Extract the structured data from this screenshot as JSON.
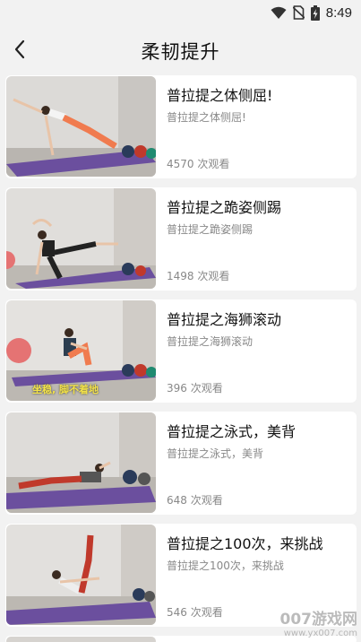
{
  "status_bar": {
    "time": "8:49",
    "icons": [
      "wifi-icon",
      "no-sim-icon",
      "battery-charging-icon"
    ]
  },
  "header": {
    "back_icon": "back-arrow-icon",
    "title": "柔韧提升"
  },
  "videos": [
    {
      "title": "普拉提之体侧屈!",
      "subtitle": "普拉提之体侧屈!",
      "views": "4570 次观看",
      "thumbnail_caption": ""
    },
    {
      "title": "普拉提之跪姿侧踢",
      "subtitle": "普拉提之跪姿侧踢",
      "views": "1498 次观看",
      "thumbnail_caption": ""
    },
    {
      "title": "普拉提之海狮滚动",
      "subtitle": "普拉提之海狮滚动",
      "views": "396 次观看",
      "thumbnail_caption": "坐稳, 脚不着地"
    },
    {
      "title": "普拉提之泳式，美背",
      "subtitle": "普拉提之泳式，美背",
      "views": "648 次观看",
      "thumbnail_caption": ""
    },
    {
      "title": "普拉提之100次，来挑战",
      "subtitle": "普拉提之100次，来挑战",
      "views": "546 次观看",
      "thumbnail_caption": ""
    }
  ],
  "watermark": {
    "main": "007游戏网",
    "sub": "www.yx007.com"
  },
  "colors": {
    "background": "#f2f2f2",
    "card": "#ffffff",
    "mat": "#6b4f9e",
    "caption": "#f3e24a"
  }
}
